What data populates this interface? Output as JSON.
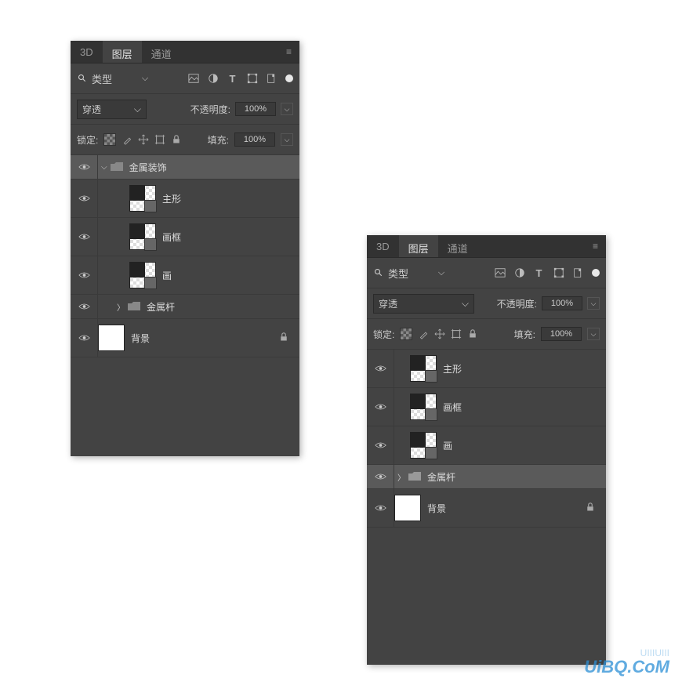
{
  "tabs": {
    "t3d": "3D",
    "layers": "图层",
    "channels": "通道"
  },
  "filter": {
    "label": "类型"
  },
  "blend": {
    "mode": "穿透",
    "opacity_label": "不透明度:",
    "opacity": "100%"
  },
  "lock": {
    "label": "锁定:",
    "fill_label": "填充:",
    "fill": "100%"
  },
  "panel1_layers": [
    {
      "name": "金属装饰",
      "type": "group-open",
      "selected": true
    },
    {
      "name": "主形",
      "type": "shape"
    },
    {
      "name": "画框",
      "type": "shape"
    },
    {
      "name": "画",
      "type": "shape"
    },
    {
      "name": "金属杆",
      "type": "group-closed"
    },
    {
      "name": "背景",
      "type": "bg",
      "locked": true
    }
  ],
  "panel2_layers": [
    {
      "name": "主形",
      "type": "shape"
    },
    {
      "name": "画框",
      "type": "shape"
    },
    {
      "name": "画",
      "type": "shape"
    },
    {
      "name": "金属杆",
      "type": "group-closed",
      "selected": true
    },
    {
      "name": "背景",
      "type": "bg",
      "locked": true
    }
  ],
  "watermark": "UiBQ.CoM",
  "watermark2": "UIIIUIII"
}
